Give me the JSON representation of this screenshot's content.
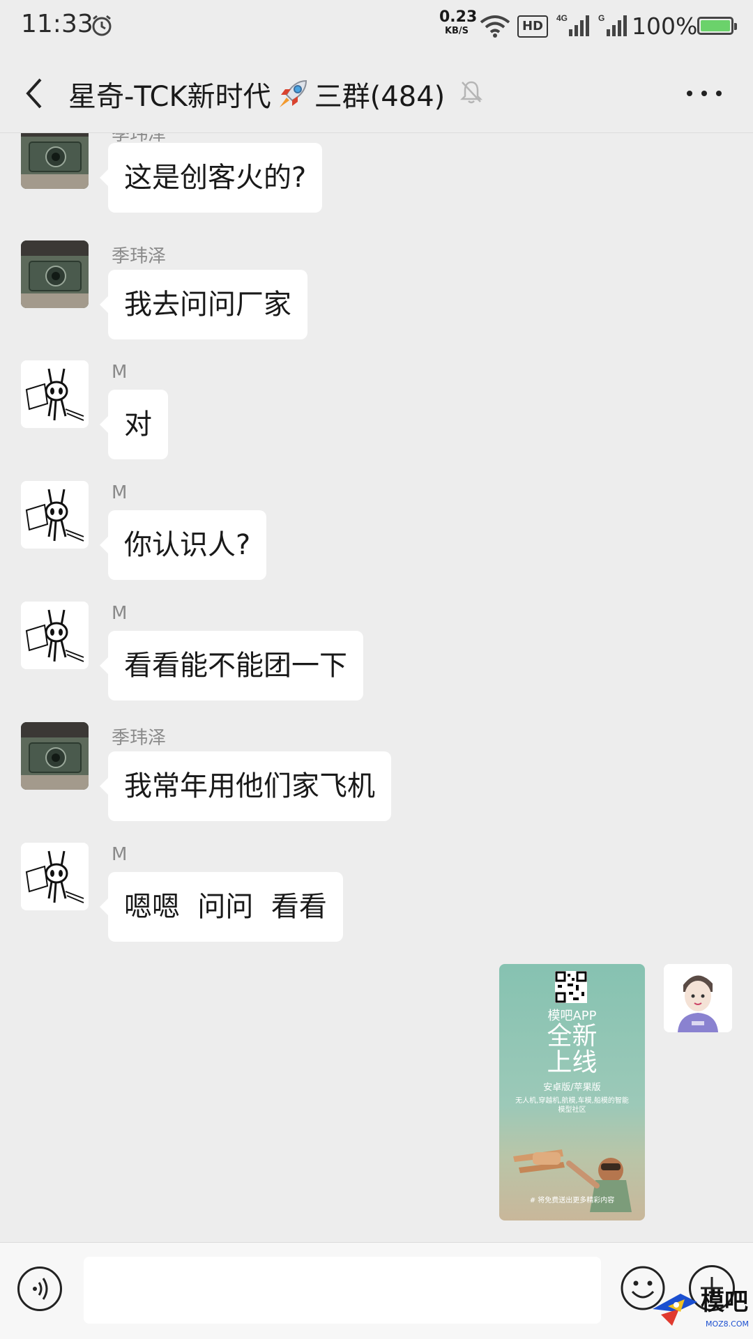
{
  "status_bar": {
    "time": "11:33",
    "net_speed_value": "0.23",
    "net_speed_unit": "KB/S",
    "hd_label": "HD",
    "signal1_label": "4G",
    "signal2_label": "G",
    "battery_percent": "100%",
    "battery_level": 1.0
  },
  "nav": {
    "title_prefix": "星奇-TCK新时代",
    "title_suffix": "三群(484)",
    "icons": [
      "back-arrow-icon",
      "rocket-emoji",
      "mute-bell-icon",
      "more-icon"
    ]
  },
  "messages": [
    {
      "sender": "季玮泽",
      "text": "这是创客火的?",
      "avatar": "camera-photo"
    },
    {
      "sender": "季玮泽",
      "text": "我去问问厂家",
      "avatar": "camera-photo"
    },
    {
      "sender": "M",
      "text": "对",
      "avatar": "sketch-drawing"
    },
    {
      "sender": "M",
      "text": "你认识人?",
      "avatar": "sketch-drawing"
    },
    {
      "sender": "M",
      "text": "看看能不能团一下",
      "avatar": "sketch-drawing"
    },
    {
      "sender": "季玮泽",
      "text": "我常年用他们家飞机",
      "avatar": "camera-photo"
    },
    {
      "sender": "M",
      "text": "嗯嗯  问问  看看",
      "avatar": "sketch-drawing"
    }
  ],
  "my_message": {
    "poster_app": "模吧APP",
    "poster_line1": "全新",
    "poster_line2": "上线",
    "poster_platforms": "安卓版/苹果版",
    "poster_desc": "无人机,穿越机,航模,车模,船模的智能模型社区",
    "poster_footer": "# 将免费送出更多精彩内容"
  },
  "input_bar": {
    "placeholder": "",
    "icons": [
      "voice-icon",
      "emoji-icon",
      "plus-icon"
    ]
  },
  "watermark": {
    "brand": "模吧",
    "url": "MOZ8.COM"
  },
  "colors": {
    "background": "#ededed",
    "bubble": "#ffffff",
    "battery_fill": "#6bd26b"
  }
}
